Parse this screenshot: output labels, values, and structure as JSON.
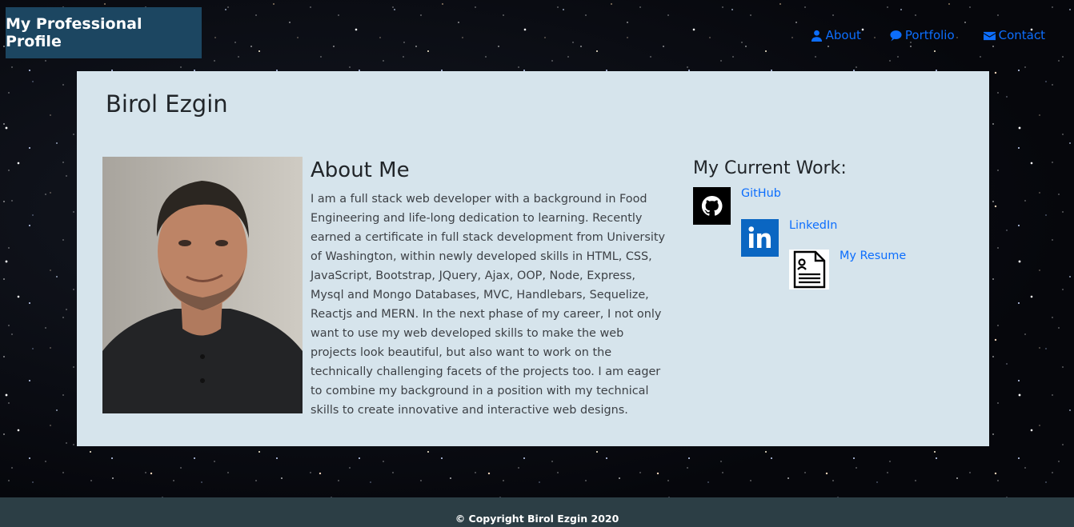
{
  "header": {
    "brand": "My Professional Profile",
    "nav": [
      {
        "label": "About",
        "icon": "user-icon"
      },
      {
        "label": "Portfolio",
        "icon": "comment-icon"
      },
      {
        "label": "Contact",
        "icon": "envelope-icon"
      }
    ]
  },
  "profile": {
    "name": "Birol Ezgin",
    "photo_icon": "profile-photo"
  },
  "about": {
    "title": "About Me",
    "text": "I am a full stack web developer with a background in Food Engineering and life-long dedication to learning. Recently earned a certificate in full stack development from University of Washington, within newly developed skills in HTML, CSS, JavaScript, Bootstrap, JQuery, Ajax, OOP, Node, Express, Mysql and Mongo Databases, MVC, Handlebars, Sequelize, Reactjs and MERN. In the next phase of my career, I not only want to use my web developed skills to make the web projects look beautiful, but also want to work on the technically challenging facets of the projects too. I am eager to combine my background in a position with my technical skills to create innovative and interactive web designs."
  },
  "work": {
    "title": "My Current Work:",
    "items": [
      {
        "label": "GitHub",
        "icon": "github-icon"
      },
      {
        "label": "LinkedIn",
        "icon": "linkedin-icon"
      },
      {
        "label": "My Resume",
        "icon": "resume-icon"
      }
    ]
  },
  "footer": {
    "text": "© Copyright Birol Ezgin 2020"
  },
  "colors": {
    "brand_bg": "#1c4661",
    "link": "#0d6efd",
    "card_bg": "#d6e4ec",
    "footer_bg": "#2c3e45"
  }
}
